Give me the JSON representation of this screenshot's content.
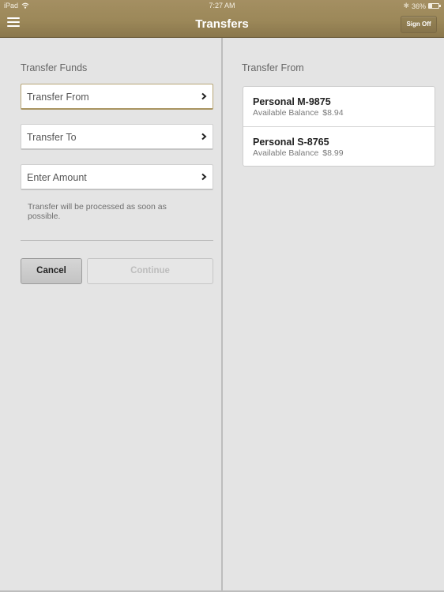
{
  "status_bar": {
    "device": "iPad",
    "time": "7:27 AM",
    "battery_percent_label": "36%",
    "battery_level": 0.36
  },
  "header": {
    "title": "Transfers",
    "sign_off_label": "Sign Off",
    "menu_icon": "hamburger-menu-icon"
  },
  "left_panel": {
    "section_title": "Transfer Funds",
    "fields": [
      {
        "label": "Transfer From",
        "active": true
      },
      {
        "label": "Transfer To",
        "active": false
      },
      {
        "label": "Enter Amount",
        "active": false
      }
    ],
    "note": "Transfer will be processed as soon as possible.",
    "cancel_label": "Cancel",
    "continue_label": "Continue",
    "continue_disabled": true
  },
  "right_panel": {
    "section_title": "Transfer From",
    "accounts": [
      {
        "name": "Personal M-9875",
        "balance_label": "Available Balance",
        "balance": "$8.94"
      },
      {
        "name": "Personal S-8765",
        "balance_label": "Available Balance",
        "balance": "$8.99"
      }
    ]
  }
}
